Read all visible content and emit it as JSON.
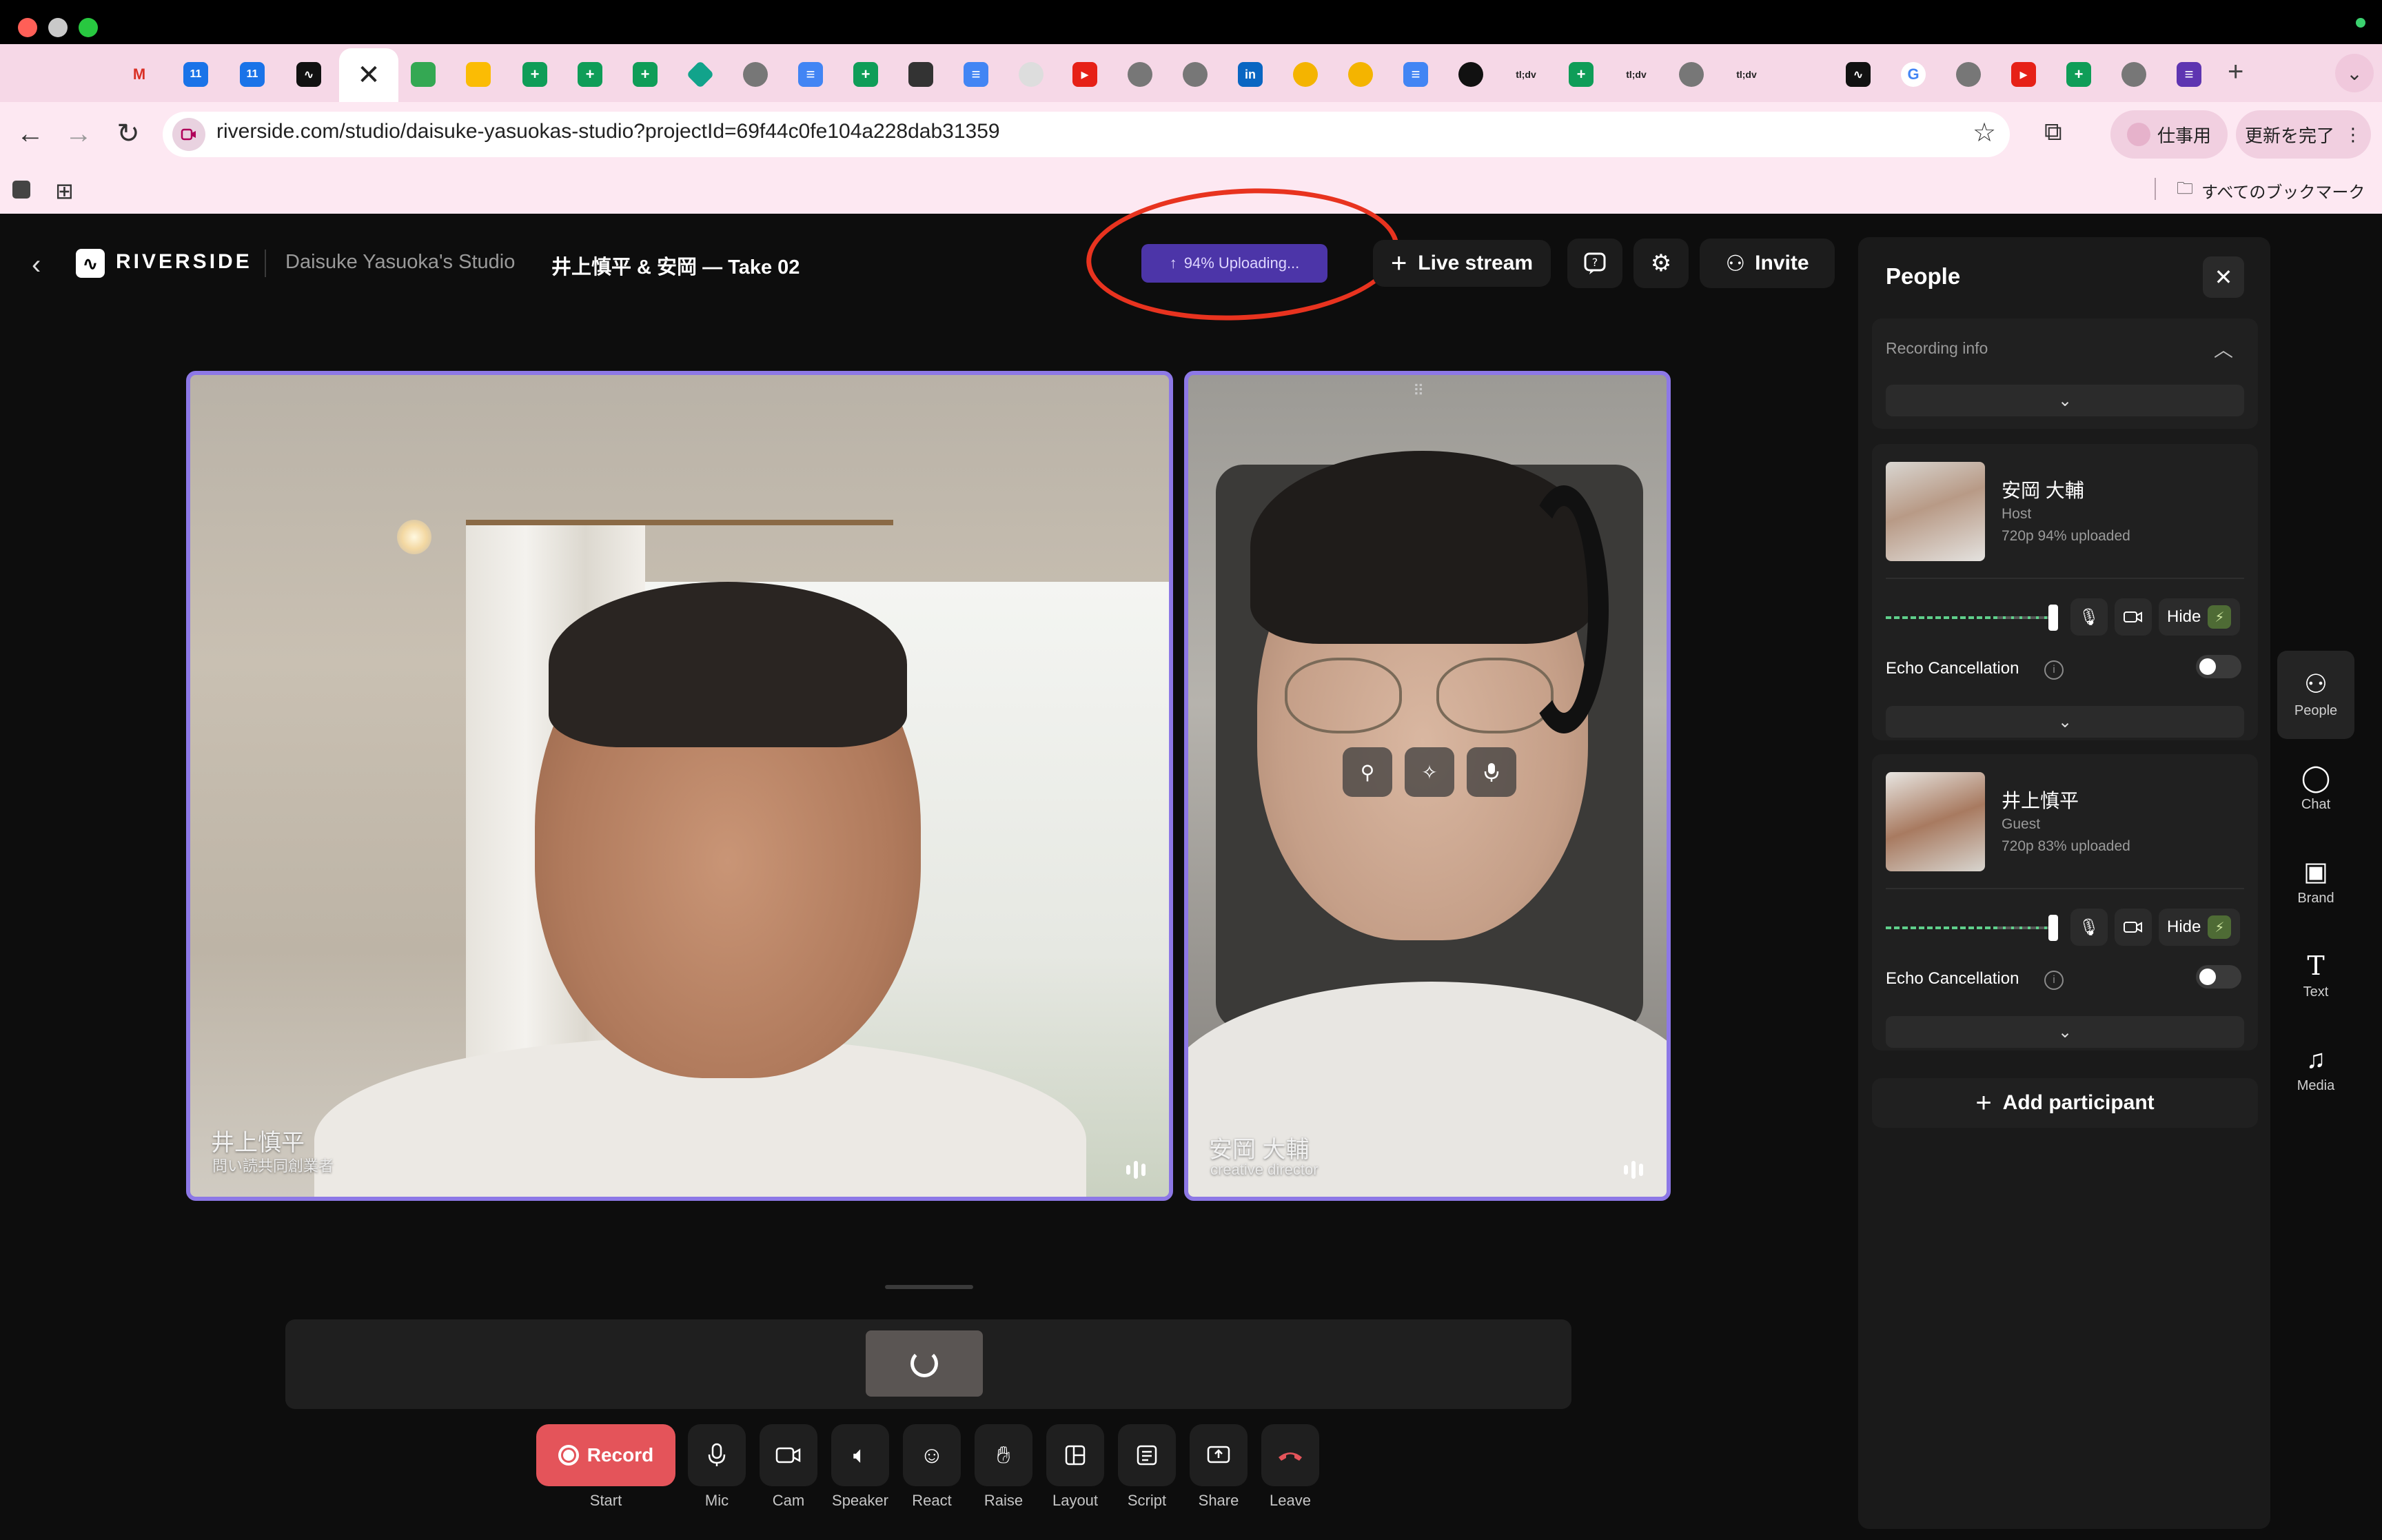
{
  "browser": {
    "tab_close_glyph": "✕",
    "new_tab_glyph": "+",
    "url": "riverside.com/studio/daisuke-yasuokas-studio?projectId=69f44c0fe104a228dab31359",
    "profile_label": "仕事用",
    "update_label": "更新を完了",
    "bookmarks_all_label": "すべてのブックマーク"
  },
  "header": {
    "logo_text": "RIVERSIDE",
    "studio_name": "Daisuke Yasuoka's Studio",
    "take_name": "井上慎平 & 安岡 — Take 02",
    "upload_status": "94% Uploading...",
    "live_stream_label": "Live stream",
    "invite_label": "Invite"
  },
  "tiles": {
    "left": {
      "name": "井上慎平",
      "subtitle": "問い読共同創業者"
    },
    "right": {
      "name": "安岡 大輔",
      "subtitle": "creative director"
    }
  },
  "controls": {
    "record_label": "Record",
    "start_label": "Start",
    "items": [
      {
        "label": "Mic"
      },
      {
        "label": "Cam"
      },
      {
        "label": "Speaker"
      },
      {
        "label": "React"
      },
      {
        "label": "Raise"
      },
      {
        "label": "Layout"
      },
      {
        "label": "Script"
      },
      {
        "label": "Share"
      },
      {
        "label": "Leave"
      }
    ]
  },
  "panel": {
    "title": "People",
    "recording_info_label": "Recording info",
    "participants": [
      {
        "name": "安岡 大輔",
        "role": "Host",
        "meta": "720p   94% uploaded",
        "hide_label": "Hide",
        "echo_label": "Echo Cancellation"
      },
      {
        "name": "井上慎平",
        "role": "Guest",
        "meta": "720p   83% uploaded",
        "hide_label": "Hide",
        "echo_label": "Echo Cancellation"
      }
    ],
    "add_participant_label": "Add participant"
  },
  "rail": [
    {
      "label": "People"
    },
    {
      "label": "Chat"
    },
    {
      "label": "Brand"
    },
    {
      "label": "Text"
    },
    {
      "label": "Media"
    }
  ],
  "colors": {
    "accent_purple": "#8d78e6",
    "upload_chip": "#4c35a8",
    "record_red": "#e4545a",
    "annotation_red": "#e8331f"
  }
}
